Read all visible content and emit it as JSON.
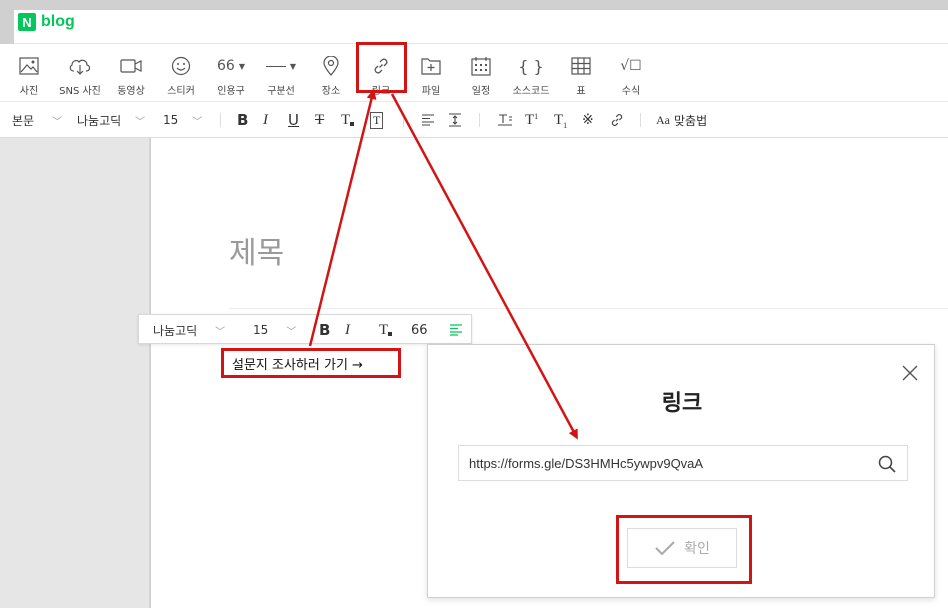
{
  "brand": {
    "mark": "N",
    "word": "blog"
  },
  "toolbar": {
    "items": [
      {
        "label": "사진",
        "icon": "image-icon"
      },
      {
        "label": "SNS 사진",
        "icon": "cloud-download-icon"
      },
      {
        "label": "동영상",
        "icon": "video-icon"
      },
      {
        "label": "스티커",
        "icon": "smiley-icon"
      },
      {
        "label": "인용구",
        "icon": "quote-icon",
        "glyph": "66"
      },
      {
        "label": "구분선",
        "icon": "divider-icon"
      },
      {
        "label": "장소",
        "icon": "map-pin-icon"
      },
      {
        "label": "링크",
        "icon": "link-icon"
      },
      {
        "label": "파일",
        "icon": "file-add-icon"
      },
      {
        "label": "일정",
        "icon": "calendar-icon"
      },
      {
        "label": "소스코드",
        "icon": "code-braces-icon",
        "glyph": "{ }"
      },
      {
        "label": "표",
        "icon": "table-icon"
      },
      {
        "label": "수식",
        "icon": "math-formula-icon",
        "glyph": "√☐"
      }
    ]
  },
  "format": {
    "paragraph": "본문",
    "font": "나눔고딕",
    "size": "15",
    "bold": "B",
    "italic": "I",
    "underline": "U",
    "strike": "T",
    "textcolor": "T",
    "bgcolor": "T",
    "superscript": "T",
    "subscript": "T",
    "spellcheck": "맞춤법"
  },
  "editor": {
    "title_placeholder": "제목"
  },
  "floatbar": {
    "font": "나눔고딕",
    "size": "15",
    "bold": "B",
    "italic": "I",
    "textcolor": "T",
    "quote": "66"
  },
  "content": {
    "link_text": "설문지 조사하러 가기 →"
  },
  "dialog": {
    "title": "링크",
    "url": "https://forms.gle/DS3HMHc5ywpv9QvaA",
    "confirm": "확인"
  },
  "colors": {
    "brand": "#03c75a",
    "annotation": "#d21414"
  }
}
